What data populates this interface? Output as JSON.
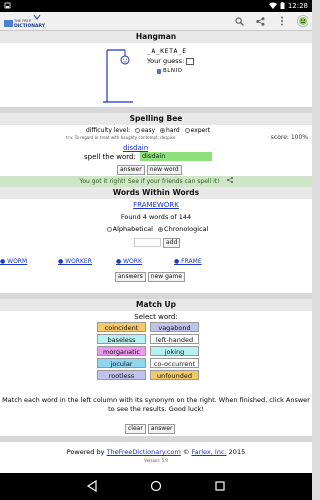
{
  "status": {
    "time": "12:28"
  },
  "appbar": {
    "logo_text": "THE FREE DICTIONARY",
    "actions": [
      "search-icon",
      "share-icon",
      "more-icon",
      "face-icon"
    ]
  },
  "hangman": {
    "title": "Hangman",
    "word": "_A_KETA_E",
    "guess_label": "Your guess:",
    "used_letters": "BLNIO"
  },
  "spelling": {
    "title": "Spelling Bee",
    "difficulty_label": "difficulty level:",
    "levels": [
      "easy",
      "hard",
      "expert"
    ],
    "selected_level": "hard",
    "definition": "tr.v. To regard or treat with haughty contempt; despise",
    "score": "score: 100%",
    "word_link": "disdain",
    "spell_label": "spell the word:",
    "input_value": "disdain",
    "answer_button": "answer",
    "new_word_button": "new word",
    "result": "You got it right! See if your friends can spell it!"
  },
  "words": {
    "title": "Words Within Words",
    "source_word": "FRAMEWORK",
    "found": "Found 4 words of 144",
    "order_alpha": "Alphabetical",
    "order_chrono": "Chronological",
    "add_button": "add",
    "list": [
      "WORM",
      "WORKER",
      "WORK",
      "FRAME"
    ],
    "answers_button": "answers",
    "new_game_button": "new game"
  },
  "match": {
    "title": "Match Up",
    "select_label": "Select word:",
    "left": [
      "coincident",
      "baseless",
      "morganatic",
      "jocular",
      "rootless"
    ],
    "right": [
      "vagabond",
      "left-handed",
      "joking",
      "co-occurrent",
      "unfounded"
    ],
    "left_colors": [
      "#f3c96a",
      "#b7f0f0",
      "#ec9af0",
      "#8fd6f0",
      "#bfc2ec"
    ],
    "right_colors": [
      "#bfc2ec",
      "#ffffff",
      "#b7f0f0",
      "#ffffff",
      "#f3c96a"
    ],
    "instructions": "Match each word in the left column with its synonym on the right. When finished, click Answer to see the results. Good luck!",
    "clear_button": "clear",
    "answer_button": "answer"
  },
  "footer": {
    "powered_by": "Powered by",
    "site1": "TheFreeDictionary.com",
    "sep": "©",
    "site2": "Farlex, Inc.",
    "year": "2015",
    "version": "Version: 5.9"
  },
  "colors": {
    "link": "#1a36c5",
    "correct_bg": "#8de07a",
    "result_bg": "#cfe5c7"
  }
}
